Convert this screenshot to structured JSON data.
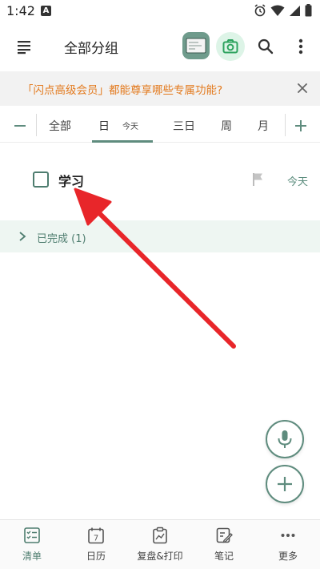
{
  "status_bar": {
    "time": "1:42",
    "notification_letter": "A"
  },
  "app_bar": {
    "title": "全部分组"
  },
  "banner": {
    "text": "「闪点高级会员」都能尊享哪些专属功能?"
  },
  "filter_tabs": {
    "items": [
      {
        "label": "全部"
      },
      {
        "label": "日"
      },
      {
        "label": "今天"
      },
      {
        "label": "三日"
      },
      {
        "label": "周"
      },
      {
        "label": "月"
      }
    ],
    "selected": "日"
  },
  "tasks": [
    {
      "title": "学习",
      "date": "今天",
      "checked": false
    }
  ],
  "completed_section": {
    "label": "已完成 (1)"
  },
  "bottom_nav": {
    "items": [
      {
        "label": "清单",
        "icon": "checklist-icon",
        "active": true
      },
      {
        "label": "日历",
        "icon": "calendar-icon",
        "calendar_day": "7"
      },
      {
        "label": "复盘&打印",
        "icon": "clipboard-chart-icon"
      },
      {
        "label": "笔记",
        "icon": "note-edit-icon"
      },
      {
        "label": "更多",
        "icon": "more-dots-icon"
      }
    ]
  },
  "colors": {
    "accent": "#5f8c7e",
    "banner_text": "#e37a1e",
    "annotation_arrow": "#e8262a",
    "completed_bg": "#eef6f2"
  }
}
